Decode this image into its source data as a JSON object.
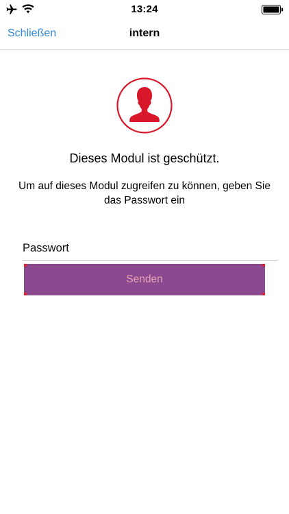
{
  "status_bar": {
    "time": "13:24",
    "icons": [
      "airplane-icon",
      "wifi-icon",
      "battery-icon"
    ]
  },
  "nav": {
    "close_label": "Schließen",
    "title": "intern"
  },
  "content": {
    "icon": "person-silhouette-icon",
    "heading": "Dieses Modul ist geschützt.",
    "description": "Um auf dieses Modul zugreifen zu können, geben Sie das Passwort ein"
  },
  "form": {
    "password_placeholder": "Passwort",
    "password_value": "",
    "submit_label": "Senden"
  },
  "colors": {
    "accent_blue": "#2f86d8",
    "icon_red": "#d8182a",
    "button_bg": "#8b4a8f",
    "button_text": "#e8a2b6"
  }
}
